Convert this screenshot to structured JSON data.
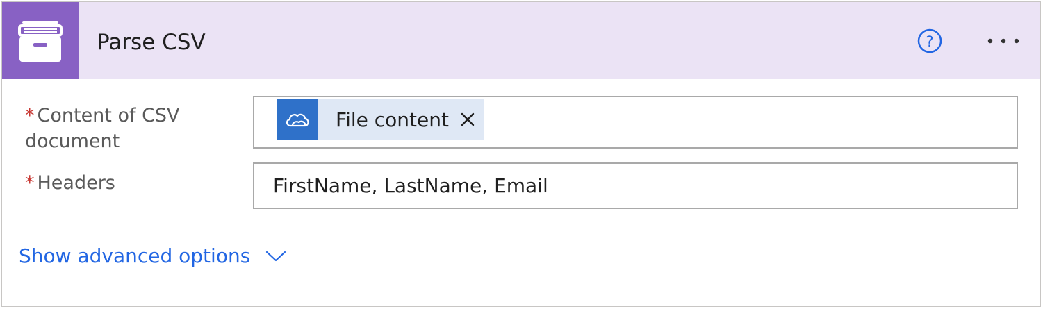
{
  "action": {
    "title": "Parse CSV",
    "icon": "file-cabinet-icon",
    "header_color": "#ebe3f5",
    "icon_color": "#8861c4"
  },
  "fields": [
    {
      "required_mark": "*",
      "label": "Content of CSV document",
      "token": {
        "icon": "onedrive-cloud-icon",
        "label": "File content"
      }
    },
    {
      "required_mark": "*",
      "label": "Headers",
      "value": "FirstName, LastName, Email"
    }
  ],
  "advanced_options": {
    "label": "Show advanced options",
    "link_color": "#2266e3"
  }
}
